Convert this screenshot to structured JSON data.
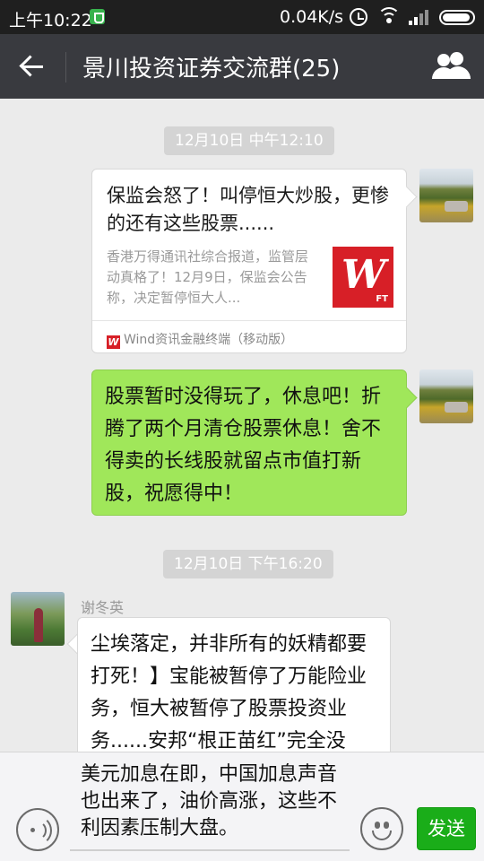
{
  "status_bar": {
    "time": "上午10:22",
    "net_speed": "0.04K/s",
    "icons": [
      "shield-icon",
      "alarm-icon",
      "wifi-icon",
      "signal-icon",
      "battery-icon"
    ]
  },
  "header": {
    "title": "景川投资证券交流群(25)",
    "back_icon": "back-arrow-icon",
    "members_icon": "group-members-icon",
    "background": "#393a3f"
  },
  "messages": [
    {
      "timestamp": "12月10日 中午12:10",
      "type": "link-card",
      "direction": "outgoing",
      "title": "保监会怒了！叫停恒大炒股，更惨的还有这些股票......",
      "description": "香港万得通讯社综合报道，监管层动真格了！12月9日，保监会公告称，决定暂停恒大人...",
      "thumbnail_label": "FT",
      "source": "Wind资讯金融终端（移动版）"
    },
    {
      "type": "text",
      "direction": "outgoing",
      "text": "股票暂时没得玩了，休息吧！折腾了两个月清仓股票休息！舍不得卖的长线股就留点市值打新股，祝愿得中！",
      "bubble_color": "#a0e75a"
    },
    {
      "timestamp": "12月10日 下午16:20",
      "type": "text",
      "direction": "incoming",
      "sender": "谢冬英",
      "text": "尘埃落定，并非所有的妖精都要打死！】宝能被暂停了万能险业务，恒大被暂停了股票投资业务......安邦“根正苗红”完全没"
    }
  ],
  "composer": {
    "draft": "美元加息在即，中国加息声音也出来了，油价高涨，这些不利因素压制大盘。",
    "send_label": "发送",
    "send_color": "#1aad19"
  }
}
